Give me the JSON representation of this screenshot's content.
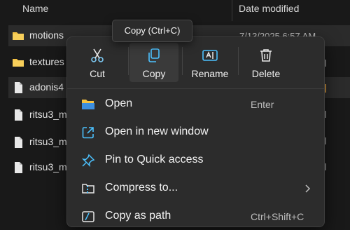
{
  "columns": {
    "name": "Name",
    "date": "Date modified"
  },
  "files": [
    {
      "name": "motions",
      "date": "7/13/2025 6:57 AM",
      "icon": "folder-icon"
    },
    {
      "name": "textures",
      "date": "",
      "icon": "folder-icon"
    },
    {
      "name": "adonis4",
      "date": "",
      "icon": "file-icon"
    },
    {
      "name": "ritsu3_m",
      "date": "",
      "icon": "file-icon"
    },
    {
      "name": "ritsu3_m",
      "date": "",
      "icon": "file-icon"
    },
    {
      "name": "ritsu3_m",
      "date": "",
      "icon": "file-icon"
    }
  ],
  "tooltip": {
    "text": "Copy (Ctrl+C)"
  },
  "context_menu": {
    "quick_actions": [
      {
        "label": "Cut",
        "icon": "scissors-icon"
      },
      {
        "label": "Copy",
        "icon": "copy-icon"
      },
      {
        "label": "Rename",
        "icon": "rename-icon"
      },
      {
        "label": "Delete",
        "icon": "trash-icon"
      }
    ],
    "items": [
      {
        "label": "Open",
        "shortcut": "Enter",
        "icon": "open-folder-icon"
      },
      {
        "label": "Open in new window",
        "shortcut": "",
        "icon": "open-window-icon"
      },
      {
        "label": "Pin to Quick access",
        "shortcut": "",
        "icon": "pin-icon"
      },
      {
        "label": "Compress to...",
        "shortcut": "",
        "icon": "zip-icon",
        "submenu": true
      },
      {
        "label": "Copy as path",
        "shortcut": "Ctrl+Shift+C",
        "icon": "path-icon"
      }
    ]
  },
  "colors": {
    "background": "#191919",
    "menu": "#2c2c2c",
    "accent": "#4cc2ff",
    "folder": "#f5c242"
  }
}
